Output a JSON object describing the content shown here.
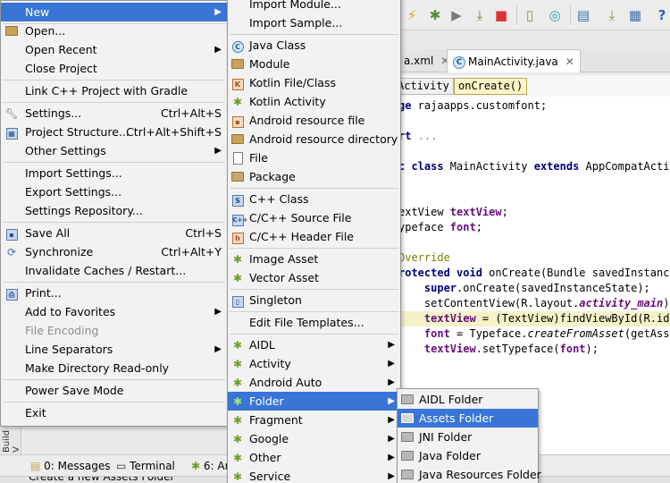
{
  "toolbar": {
    "icons": [
      "run-icon",
      "debug-icon",
      "attach-debugger-icon",
      "apply-changes-icon",
      "stop-icon",
      "avd-manager-icon",
      "sync-gradle-icon",
      "project-structure-icon",
      "sdk-manager-icon",
      "help-icon"
    ]
  },
  "editor_tabs": [
    {
      "label": "a.xml",
      "active": false
    },
    {
      "label": "MainActivity.java",
      "active": true,
      "badge": "C"
    }
  ],
  "breadcrumbs": [
    "Activity",
    "onCreate()"
  ],
  "code": [
    "ge rajaapps.customfont;",
    "",
    "rt ...",
    "",
    "c class MainActivity extends AppCompatActiv",
    "",
    "",
    "extView textView;",
    "ypeface font;",
    "",
    "Override",
    "rotected void onCreate(Bundle savedInstance",
    "    super.onCreate(savedInstanceState);",
    "    setContentView(R.layout.activity_main);",
    "    textView = (TextView)findViewById(R.id.t",
    "    font = Typeface.createFromAsset(getAsset",
    "    textView.setTypeface(font);"
  ],
  "bottom_bar": {
    "messages": "0: Messages",
    "terminal": "Terminal",
    "android": "6: Ar"
  },
  "side_label": "Build V",
  "status_text": "Create a new Assets Folder",
  "main_menu": {
    "items": [
      {
        "label": "New",
        "icon": "",
        "arrow": true,
        "selected": true
      },
      {
        "sep": true
      },
      {
        "label": "Open...",
        "icon": "folder-icon"
      },
      {
        "label": "Open Recent",
        "arrow": true
      },
      {
        "label": "Close Project"
      },
      {
        "sep": true
      },
      {
        "label": "Link C++ Project with Gradle"
      },
      {
        "sep": true
      },
      {
        "label": "Settings...",
        "shortcut": "Ctrl+Alt+S",
        "icon": "wrench-icon"
      },
      {
        "label": "Project Structure...",
        "shortcut": "Ctrl+Alt+Shift+S",
        "icon": "project-structure-icon"
      },
      {
        "label": "Other Settings",
        "arrow": true
      },
      {
        "sep": true
      },
      {
        "label": "Import Settings..."
      },
      {
        "label": "Export Settings..."
      },
      {
        "label": "Settings Repository..."
      },
      {
        "sep": true
      },
      {
        "label": "Save All",
        "shortcut": "Ctrl+S",
        "icon": "save-icon"
      },
      {
        "label": "Synchronize",
        "shortcut": "Ctrl+Alt+Y",
        "icon": "sync-icon"
      },
      {
        "label": "Invalidate Caches / Restart..."
      },
      {
        "sep": true
      },
      {
        "label": "Print...",
        "icon": "print-icon"
      },
      {
        "label": "Add to Favorites",
        "arrow": true
      },
      {
        "label": "File Encoding",
        "disabled": true
      },
      {
        "label": "Line Separators",
        "arrow": true
      },
      {
        "label": "Make Directory Read-only"
      },
      {
        "sep": true
      },
      {
        "label": "Power Save Mode"
      },
      {
        "sep": true
      },
      {
        "label": "Exit"
      }
    ]
  },
  "new_menu": {
    "items": [
      {
        "label": "Import Module..."
      },
      {
        "label": "Import Sample..."
      },
      {
        "sep": true
      },
      {
        "label": "Java Class",
        "icon": "java-class-icon"
      },
      {
        "label": "Module",
        "icon": "module-icon"
      },
      {
        "label": "Kotlin File/Class",
        "icon": "kotlin-icon"
      },
      {
        "label": "Kotlin Activity",
        "icon": "android-icon"
      },
      {
        "label": "Android resource file",
        "icon": "resource-file-icon"
      },
      {
        "label": "Android resource directory",
        "icon": "folder-icon"
      },
      {
        "label": "File",
        "icon": "file-icon"
      },
      {
        "label": "Package",
        "icon": "package-icon"
      },
      {
        "sep": true
      },
      {
        "label": "C++ Class",
        "icon": "cpp-class-icon"
      },
      {
        "label": "C/C++ Source File",
        "icon": "cpp-source-icon"
      },
      {
        "label": "C/C++ Header File",
        "icon": "cpp-header-icon"
      },
      {
        "sep": true
      },
      {
        "label": "Image Asset",
        "icon": "android-icon"
      },
      {
        "label": "Vector Asset",
        "icon": "android-icon"
      },
      {
        "sep": true
      },
      {
        "label": "Singleton",
        "icon": "singleton-icon"
      },
      {
        "sep": true
      },
      {
        "label": "Edit File Templates..."
      },
      {
        "sep": true
      },
      {
        "label": "AIDL",
        "icon": "android-icon",
        "arrow": true
      },
      {
        "label": "Activity",
        "icon": "android-icon",
        "arrow": true
      },
      {
        "label": "Android Auto",
        "icon": "android-icon",
        "arrow": true
      },
      {
        "label": "Folder",
        "icon": "android-icon",
        "arrow": true,
        "selected": true
      },
      {
        "label": "Fragment",
        "icon": "android-icon",
        "arrow": true
      },
      {
        "label": "Google",
        "icon": "android-icon",
        "arrow": true
      },
      {
        "label": "Other",
        "icon": "android-icon",
        "arrow": true
      },
      {
        "label": "Service",
        "icon": "android-icon",
        "arrow": true
      }
    ]
  },
  "folder_menu": {
    "items": [
      {
        "label": "AIDL Folder",
        "icon": "folder-icon"
      },
      {
        "label": "Assets Folder",
        "icon": "folder-icon",
        "selected": true
      },
      {
        "label": "JNI Folder",
        "icon": "folder-icon"
      },
      {
        "label": "Java Folder",
        "icon": "folder-icon"
      },
      {
        "label": "Java Resources Folder",
        "icon": "folder-icon"
      }
    ]
  },
  "colors": {
    "selection": "#3875d7",
    "menu_bg": "#f2f2f2",
    "keyword": "#000080",
    "field": "#660e7a",
    "annotation": "#808000"
  }
}
